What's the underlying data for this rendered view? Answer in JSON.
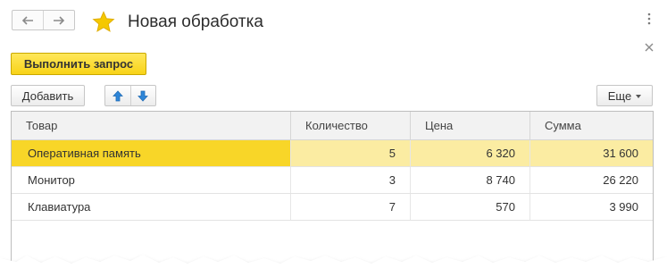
{
  "window": {
    "title": "Новая обработка"
  },
  "toolbar": {
    "run_label": "Выполнить запрос",
    "add_label": "Добавить",
    "more_label": "Еще"
  },
  "table": {
    "columns": [
      "Товар",
      "Количество",
      "Цена",
      "Сумма"
    ],
    "rows": [
      [
        "Оперативная память",
        "5",
        "6 320",
        "31 600"
      ],
      [
        "Монитор",
        "3",
        "8 740",
        "26 220"
      ],
      [
        "Клавиатура",
        "7",
        "570",
        "3 990"
      ]
    ],
    "selected_row": 0
  },
  "colors": {
    "accent_yellow": "#f8d628",
    "selected_row_bg": "#fbeca2",
    "arrow_blue": "#2e86d8",
    "star": "#f5c800"
  },
  "icons": [
    "arrow-left-icon",
    "arrow-right-icon",
    "star-icon",
    "window-menu-icon",
    "close-icon",
    "arrow-up-icon",
    "arrow-down-icon",
    "chevron-down-icon"
  ]
}
